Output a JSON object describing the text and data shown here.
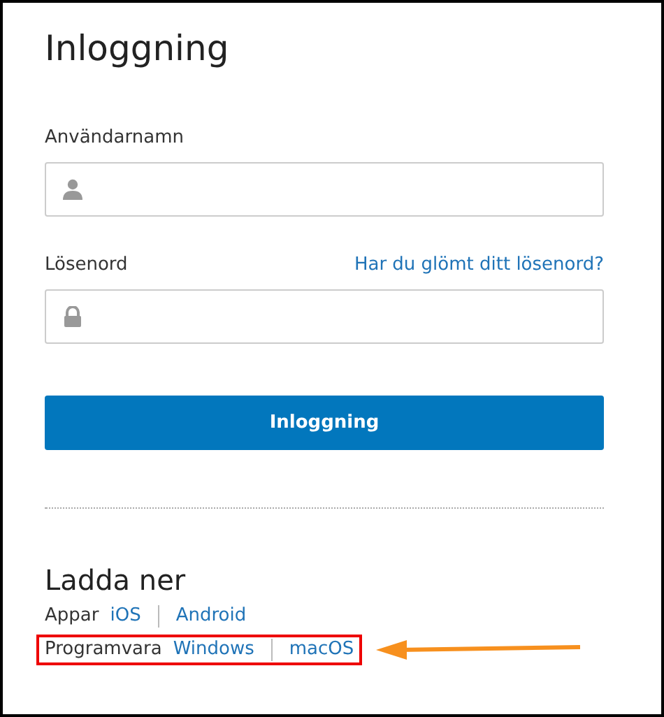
{
  "title": "Inloggning",
  "username": {
    "label": "Användarnamn"
  },
  "password": {
    "label": "Lösenord",
    "forgot_link": "Har du glömt ditt lösenord?"
  },
  "login_button": "Inloggning",
  "downloads": {
    "heading": "Ladda ner",
    "rows": [
      {
        "label": "Appar",
        "links": [
          "iOS",
          "Android"
        ],
        "highlighted": false
      },
      {
        "label": "Programvara",
        "links": [
          "Windows",
          "macOS"
        ],
        "highlighted": true
      }
    ]
  }
}
